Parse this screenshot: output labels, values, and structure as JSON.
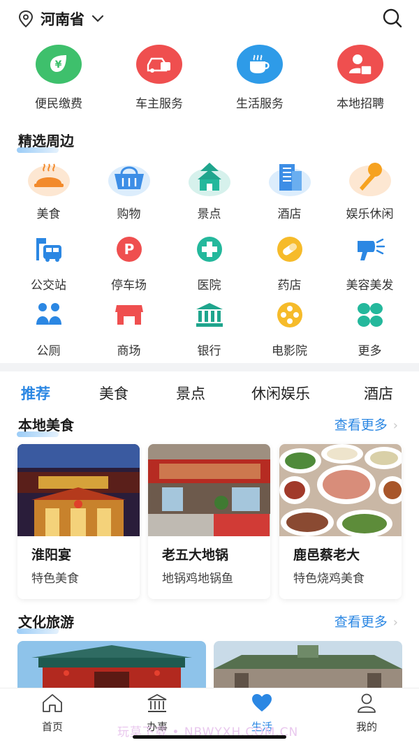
{
  "header": {
    "location": "河南省",
    "icons": {
      "pin": "location-pin-icon",
      "chevron": "chevron-down-icon",
      "search": "search-icon"
    }
  },
  "services": [
    {
      "label": "便民缴费",
      "icon": "yuan-leaf-icon",
      "color": "#3ec06c"
    },
    {
      "label": "车主服务",
      "icon": "car-icon",
      "color": "#ef4f4f"
    },
    {
      "label": "生活服务",
      "icon": "cup-icon",
      "color": "#2e9be8"
    },
    {
      "label": "本地招聘",
      "icon": "recruit-person-icon",
      "color": "#ef4f4f"
    }
  ],
  "nearby": {
    "title": "精选周边",
    "items": [
      {
        "label": "美食",
        "icon": "food-dish-icon"
      },
      {
        "label": "购物",
        "icon": "shopping-basket-icon"
      },
      {
        "label": "景点",
        "icon": "temple-icon"
      },
      {
        "label": "酒店",
        "icon": "hotel-building-icon"
      },
      {
        "label": "娱乐休闲",
        "icon": "microphone-icon"
      },
      {
        "label": "公交站",
        "icon": "bus-stop-icon"
      },
      {
        "label": "停车场",
        "icon": "parking-icon"
      },
      {
        "label": "医院",
        "icon": "hospital-cross-icon"
      },
      {
        "label": "药店",
        "icon": "pill-icon"
      },
      {
        "label": "美容美发",
        "icon": "hair-dryer-icon"
      },
      {
        "label": "公厕",
        "icon": "toilet-people-icon"
      },
      {
        "label": "商场",
        "icon": "mall-store-icon"
      },
      {
        "label": "银行",
        "icon": "bank-icon"
      },
      {
        "label": "电影院",
        "icon": "film-reel-icon"
      },
      {
        "label": "更多",
        "icon": "more-grid-icon"
      }
    ]
  },
  "tabs": [
    {
      "label": "推荐",
      "active": true
    },
    {
      "label": "美食",
      "active": false
    },
    {
      "label": "景点",
      "active": false
    },
    {
      "label": "休闲娱乐",
      "active": false
    },
    {
      "label": "酒店",
      "active": false
    }
  ],
  "local_food": {
    "title": "本地美食",
    "more": "查看更多",
    "cards": [
      {
        "name": "淮阳宴",
        "desc": "特色美食"
      },
      {
        "name": "老五大地锅",
        "desc": "地锅鸡地锅鱼"
      },
      {
        "name": "鹿邑蔡老大",
        "desc": "特色烧鸡美食"
      }
    ]
  },
  "culture_tour": {
    "title": "文化旅游",
    "more": "查看更多"
  },
  "bottom_nav": [
    {
      "label": "首页",
      "icon": "home-icon",
      "active": false
    },
    {
      "label": "办事",
      "icon": "government-building-icon",
      "active": false
    },
    {
      "label": "生活",
      "icon": "heart-icon",
      "active": true
    },
    {
      "label": "我的",
      "icon": "user-icon",
      "active": false
    }
  ],
  "watermark": "玩莫下载 • NBWYXH.COM.CN",
  "colors": {
    "accent": "#2b87e3"
  }
}
